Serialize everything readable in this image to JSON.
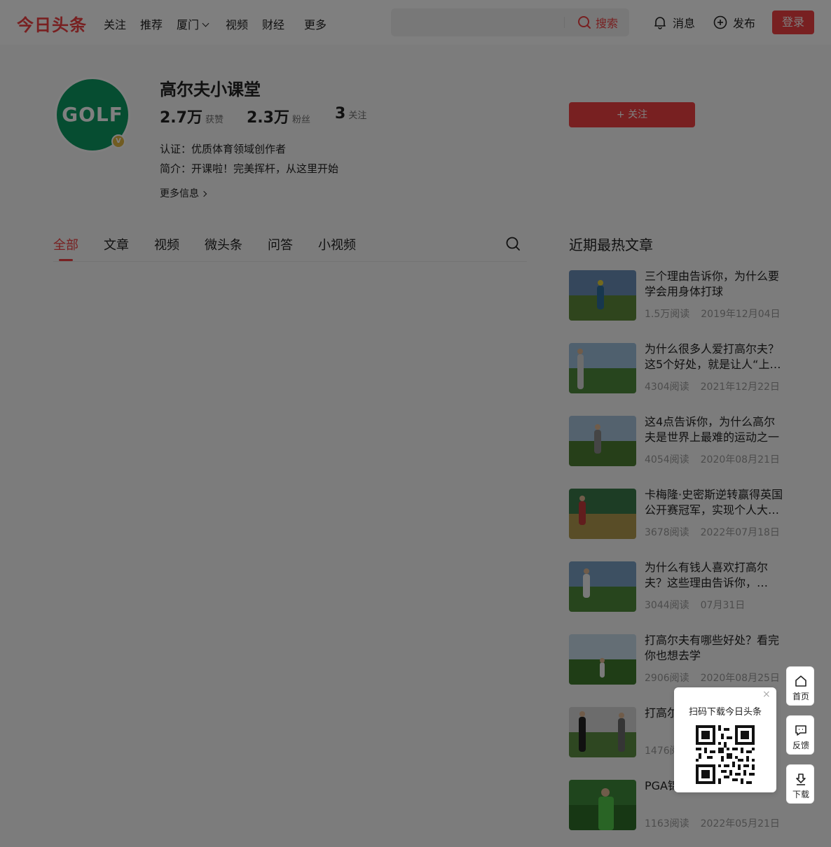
{
  "header": {
    "logo": "今日头条",
    "nav": [
      {
        "label": "关注"
      },
      {
        "label": "推荐"
      },
      {
        "label": "厦门"
      },
      {
        "label": "视频"
      },
      {
        "label": "财经"
      },
      {
        "label": "更多"
      }
    ],
    "search": {
      "placeholder": "",
      "button_label": "搜索"
    },
    "messages_label": "消息",
    "publish_label": "发布",
    "login_label": "登录"
  },
  "profile": {
    "avatar_text": "GOLF",
    "verified_mark": "V",
    "name": "高尔夫小课堂",
    "stats": [
      {
        "num": "2.7万",
        "label": "获赞"
      },
      {
        "num": "2.3万",
        "label": "粉丝"
      },
      {
        "num": "3",
        "label": "关注"
      }
    ],
    "certification": "认证：优质体育领域创作者",
    "intro": "简介：开课啦！完美挥杆，从这里开始",
    "more_info": "更多信息",
    "follow_label": "+ 关注"
  },
  "tabs": [
    {
      "label": "全部",
      "active": true
    },
    {
      "label": "文章"
    },
    {
      "label": "视频"
    },
    {
      "label": "微头条"
    },
    {
      "label": "问答"
    },
    {
      "label": "小视频"
    }
  ],
  "hot": {
    "title": "近期最热文章",
    "articles": [
      {
        "title": "三个理由告诉你，为什么要学会用身体打球",
        "reads": "1.5万阅读",
        "date": "2019年12月04日"
      },
      {
        "title": "为什么很多人爱打高尔夫？这5个好处，就是让人“上…",
        "reads": "4304阅读",
        "date": "2021年12月22日"
      },
      {
        "title": "这4点告诉你，为什么高尔夫是世界上最难的运动之一",
        "reads": "4054阅读",
        "date": "2020年08月21日"
      },
      {
        "title": "卡梅隆·史密斯逆转赢得英国公开赛冠军，实现个人大…",
        "reads": "3678阅读",
        "date": "2022年07月18日"
      },
      {
        "title": "为什么有钱人喜欢打高尔夫？这些理由告诉你，…",
        "reads": "3044阅读",
        "date": "07月31日"
      },
      {
        "title": "打高尔夫有哪些好处？看完你也想去学",
        "reads": "2906阅读",
        "date": "2020年08月25日"
      },
      {
        "title": "打高尔夫乐，也…",
        "reads": "1476阅读",
        "date": ""
      },
      {
        "title": "PGA锦标赛托利斯…",
        "reads": "1163阅读",
        "date": "2022年05月21日"
      }
    ]
  },
  "qr": {
    "label": "扫码下载今日头条",
    "close": "×"
  },
  "side_tools": [
    {
      "label": "首页"
    },
    {
      "label": "反馈"
    },
    {
      "label": "下载"
    }
  ]
}
